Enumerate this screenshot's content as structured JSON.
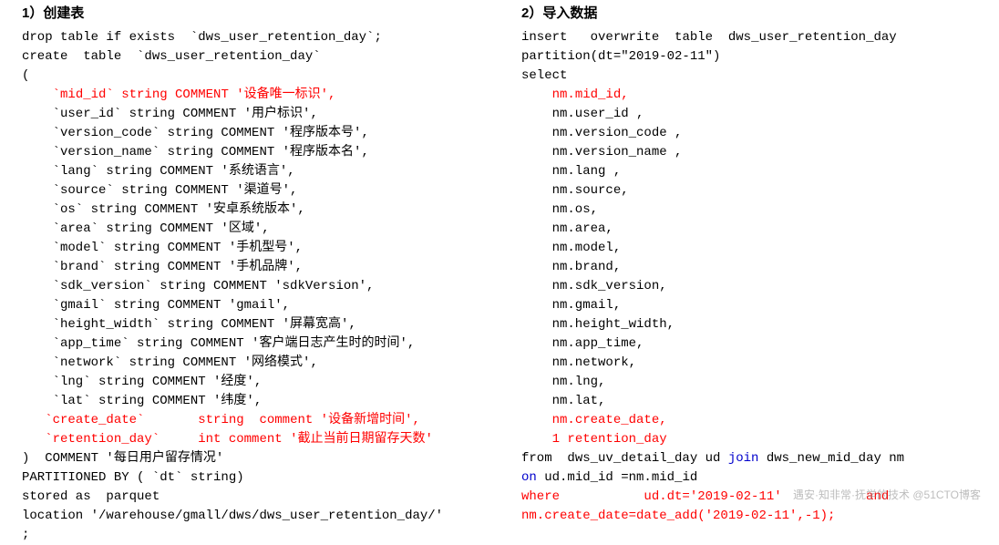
{
  "left": {
    "title": "1）创建表",
    "lines": [
      [
        {
          "t": "drop table if exists  `dws_user_retention_day`;"
        }
      ],
      [
        {
          "t": "create  table  `dws_user_retention_day`"
        }
      ],
      [
        {
          "t": "("
        }
      ],
      [
        {
          "t": "    "
        },
        {
          "t": "`mid_id` string COMMENT '设备唯一标识',",
          "c": "red"
        }
      ],
      [
        {
          "t": "    `user_id` string COMMENT '用户标识', "
        }
      ],
      [
        {
          "t": "    `version_code` string COMMENT '程序版本号', "
        }
      ],
      [
        {
          "t": "    `version_name` string COMMENT '程序版本名', "
        }
      ],
      [
        {
          "t": "    `lang` string COMMENT '系统语言', "
        }
      ],
      [
        {
          "t": "    `source` string COMMENT '渠道号', "
        }
      ],
      [
        {
          "t": "    `os` string COMMENT '安卓系统版本', "
        }
      ],
      [
        {
          "t": "    `area` string COMMENT '区域', "
        }
      ],
      [
        {
          "t": "    `model` string COMMENT '手机型号', "
        }
      ],
      [
        {
          "t": "    `brand` string COMMENT '手机品牌', "
        }
      ],
      [
        {
          "t": "    `sdk_version` string COMMENT 'sdkVersion', "
        }
      ],
      [
        {
          "t": "    `gmail` string COMMENT 'gmail', "
        }
      ],
      [
        {
          "t": "    `height_width` string COMMENT '屏幕宽高',"
        }
      ],
      [
        {
          "t": "    `app_time` string COMMENT '客户端日志产生时的时间',"
        }
      ],
      [
        {
          "t": "    `network` string COMMENT '网络模式',"
        }
      ],
      [
        {
          "t": "    `lng` string COMMENT '经度',"
        }
      ],
      [
        {
          "t": "    `lat` string COMMENT '纬度',"
        }
      ],
      [
        {
          "t": "   "
        },
        {
          "t": "`create_date`       string  comment '设备新增时间',",
          "c": "red"
        }
      ],
      [
        {
          "t": "   "
        },
        {
          "t": "`retention_day`     int comment '截止当前日期留存天数'",
          "c": "red"
        }
      ],
      [
        {
          "t": ")  COMMENT '每日用户留存情况'"
        }
      ],
      [
        {
          "t": "PARTITIONED BY ( `dt` string)"
        }
      ],
      [
        {
          "t": "stored as  parquet"
        }
      ],
      [
        {
          "t": "location '/warehouse/gmall/dws/dws_user_retention_day/'"
        }
      ],
      [
        {
          "t": ";"
        }
      ]
    ]
  },
  "right": {
    "title": "2）导入数据",
    "lines": [
      [
        {
          "t": "insert   "
        },
        {
          "t": "overwrite"
        },
        {
          "t": "  table  dws_user_retention_day"
        }
      ],
      [
        {
          "t": "partition(dt=\"2019-02-11\")"
        }
      ],
      [
        {
          "t": "select"
        }
      ],
      [
        {
          "t": "    "
        },
        {
          "t": "nm.mid_id,",
          "c": "red"
        }
      ],
      [
        {
          "t": "    nm.user_id ,"
        }
      ],
      [
        {
          "t": "    nm.version_code ,"
        }
      ],
      [
        {
          "t": "    nm.version_name ,"
        }
      ],
      [
        {
          "t": "    nm.lang ,"
        }
      ],
      [
        {
          "t": "    nm.source,"
        }
      ],
      [
        {
          "t": "    nm.os,"
        }
      ],
      [
        {
          "t": "    nm.area,"
        }
      ],
      [
        {
          "t": "    nm.model,"
        }
      ],
      [
        {
          "t": "    nm.brand,"
        }
      ],
      [
        {
          "t": "    nm.sdk_version,"
        }
      ],
      [
        {
          "t": "    nm.gmail,"
        }
      ],
      [
        {
          "t": "    nm.height_width,"
        }
      ],
      [
        {
          "t": "    nm.app_time,"
        }
      ],
      [
        {
          "t": "    nm.network,"
        }
      ],
      [
        {
          "t": "    nm.lng,"
        }
      ],
      [
        {
          "t": "    nm.lat,"
        }
      ],
      [
        {
          "t": "    "
        },
        {
          "t": "nm.create_date,",
          "c": "red"
        }
      ],
      [
        {
          "t": "    "
        },
        {
          "t": "1 retention_day",
          "c": "red"
        }
      ],
      [
        {
          "t": "from"
        },
        {
          "t": "  dws_uv_detail_day ud "
        },
        {
          "t": "join",
          "c": "blue"
        },
        {
          "t": " dws_new_mid_day nm "
        }
      ],
      [
        {
          "t": "on",
          "c": "blue"
        },
        {
          "t": " ud.mid_id =nm.mid_id"
        }
      ],
      [
        {
          "t": "where           ud.dt='2019-02-11'           and",
          "c": "red"
        }
      ],
      [
        {
          "t": "nm.create_date=date_add('2019-02-11',-1);",
          "c": "red"
        }
      ]
    ]
  },
  "watermark": "遇安·知非常·抚学的技术 @51CTO博客"
}
